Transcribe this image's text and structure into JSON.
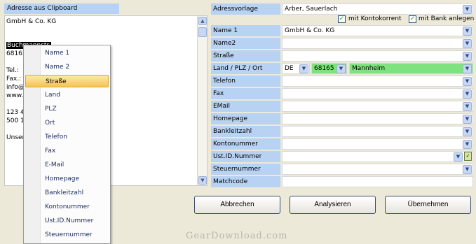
{
  "left": {
    "header": "Adresse aus Clipboard",
    "lines": [
      {
        "text": "GmbH & Co. KG"
      },
      {
        "text": "Buchmannstr.",
        "selected": true
      },
      {
        "text": "68165"
      },
      {
        "text": "Tel.:"
      },
      {
        "text": "Fax.:"
      },
      {
        "text": "info@"
      },
      {
        "text": "www."
      },
      {
        "text": "123 4"
      },
      {
        "text": "500 1"
      },
      {
        "text": "Unser"
      }
    ]
  },
  "menu": {
    "items": [
      "Name 1",
      "Name 2",
      "Straße",
      "Land",
      "PLZ",
      "Ort",
      "Telefon",
      "Fax",
      "E-Mail",
      "Homepage",
      "Bankleitzahl",
      "Kontonummer",
      "Ust.ID.Nummer",
      "Steuernummer"
    ],
    "active_index": 2
  },
  "form": {
    "template_label": "Adressvorlage",
    "template_value": "Arber, Sauerlach",
    "opt_konto_label": "mit Kontokorrent",
    "opt_bank_label": "mit Bank anlegen",
    "rows": [
      {
        "label": "Name 1",
        "value": "GmbH & Co. KG"
      },
      {
        "label": "Name2",
        "value": ""
      },
      {
        "label": "Straße",
        "value": ""
      },
      {
        "label": "Land / PLZ / Ort",
        "value": ""
      },
      {
        "label": "Telefon",
        "value": ""
      },
      {
        "label": "Fax",
        "value": ""
      },
      {
        "label": "EMail",
        "value": ""
      },
      {
        "label": "Homepage",
        "value": ""
      },
      {
        "label": "Bankleitzahl",
        "value": ""
      },
      {
        "label": "Kontonummer",
        "value": ""
      },
      {
        "label": "Ust.ID.Nummer",
        "value": ""
      },
      {
        "label": "Steuernummer",
        "value": ""
      },
      {
        "label": "Matchcode",
        "value": ""
      }
    ],
    "land": "DE",
    "plz": "68165",
    "ort": "Mannheim"
  },
  "buttons": {
    "cancel": "Abbrechen",
    "analyze": "Analysieren",
    "apply": "Übernehmen"
  },
  "watermark": "GearDownload.com",
  "colors": {
    "label_bg": "#b7d2f2",
    "green": "#7ee27e",
    "menu_active": "#f7c355"
  }
}
